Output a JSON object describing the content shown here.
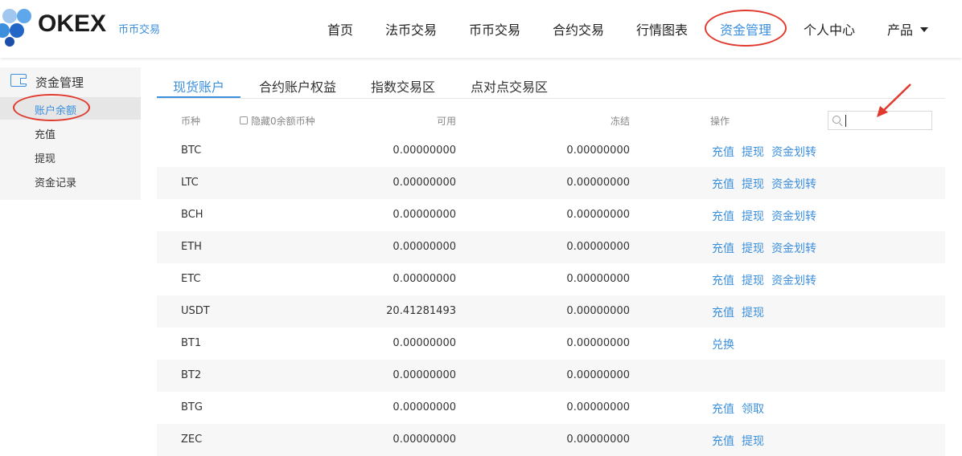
{
  "header": {
    "brand": "OKEX",
    "brand_sub": "币币交易",
    "nav": [
      "首页",
      "法币交易",
      "币币交易",
      "合约交易",
      "行情图表",
      "资金管理",
      "个人中心",
      "产品"
    ],
    "accent_color": "#3b8fdc",
    "annotation_color": "#e03a2f"
  },
  "sidebar": {
    "title": "资金管理",
    "items": [
      "账户余额",
      "充值",
      "提现",
      "资金记录"
    ],
    "active_index": 0
  },
  "tabs": [
    "现货账户",
    "合约账户权益",
    "指数交易区",
    "点对点交易区"
  ],
  "table": {
    "headers": {
      "coin": "币种",
      "hide_zero": "隐藏0余额币种",
      "available": "可用",
      "frozen": "冻结",
      "actions": "操作"
    },
    "search": {
      "value": "",
      "placeholder": ""
    },
    "rows": [
      {
        "coin": "BTC",
        "available": "0.00000000",
        "frozen": "0.00000000",
        "actions": [
          "充值",
          "提现",
          "资金划转"
        ]
      },
      {
        "coin": "LTC",
        "available": "0.00000000",
        "frozen": "0.00000000",
        "actions": [
          "充值",
          "提现",
          "资金划转"
        ]
      },
      {
        "coin": "BCH",
        "available": "0.00000000",
        "frozen": "0.00000000",
        "actions": [
          "充值",
          "提现",
          "资金划转"
        ]
      },
      {
        "coin": "ETH",
        "available": "0.00000000",
        "frozen": "0.00000000",
        "actions": [
          "充值",
          "提现",
          "资金划转"
        ]
      },
      {
        "coin": "ETC",
        "available": "0.00000000",
        "frozen": "0.00000000",
        "actions": [
          "充值",
          "提现",
          "资金划转"
        ]
      },
      {
        "coin": "USDT",
        "available": "20.41281493",
        "frozen": "0.00000000",
        "actions": [
          "充值",
          "提现"
        ]
      },
      {
        "coin": "BT1",
        "available": "0.00000000",
        "frozen": "0.00000000",
        "actions": [
          "兑换"
        ]
      },
      {
        "coin": "BT2",
        "available": "0.00000000",
        "frozen": "0.00000000",
        "actions": []
      },
      {
        "coin": "BTG",
        "available": "0.00000000",
        "frozen": "0.00000000",
        "actions": [
          "充值",
          "领取"
        ]
      },
      {
        "coin": "ZEC",
        "available": "0.00000000",
        "frozen": "0.00000000",
        "actions": [
          "充值",
          "提现"
        ]
      }
    ]
  }
}
